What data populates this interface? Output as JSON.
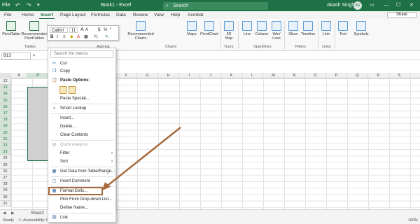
{
  "titlebar": {
    "file_label": "File",
    "window_title": "Book1 - Excel",
    "search_placeholder": "Search",
    "user_name": "Akash Singh",
    "avatar_initials": "AS"
  },
  "ribbon_tabs": [
    "File",
    "Home",
    "Insert",
    "Page Layout",
    "Formulas",
    "Data",
    "Review",
    "View",
    "Help",
    "Acrobat"
  ],
  "active_tab": "Insert",
  "share_label": "Share",
  "ribbon": {
    "buttons": [
      "PivotTable",
      "Recommended PivotTables",
      "Recommended Charts",
      "Maps",
      "PivotChart",
      "3D Map",
      "Line",
      "Column",
      "Win/ Loss",
      "Slicer",
      "Timeline",
      "Link",
      "Text",
      "Symbols"
    ],
    "groups": [
      "Tables",
      "Add-ins",
      "Charts",
      "Tours",
      "Sparklines",
      "Filters",
      "Links"
    ]
  },
  "mini_toolbar": {
    "font": "Calibri",
    "size": "11",
    "currency": "$",
    "percent": "%"
  },
  "formula_bar": {
    "name_box": "B13",
    "fx": "fx"
  },
  "columns": [
    "A",
    "B",
    "C",
    "D",
    "E",
    "F",
    "G",
    "H",
    "I",
    "J",
    "K",
    "L",
    "M",
    "N",
    "O",
    "P",
    "Q",
    "R",
    "S"
  ],
  "rows": [
    "12",
    "13",
    "14",
    "15",
    "16",
    "17",
    "18",
    "19",
    "20",
    "21",
    "22",
    "23",
    "24",
    "25",
    "26",
    "27",
    "28",
    "29",
    "30",
    "31"
  ],
  "context_menu": {
    "search_placeholder": "Search the menus",
    "items": [
      {
        "label": "Cut",
        "icon": "scissors-icon"
      },
      {
        "label": "Copy",
        "icon": "copy-icon"
      },
      {
        "label": "Paste Options:",
        "icon": "paste-icon"
      },
      {
        "label": "Paste Special...",
        "icon": ""
      },
      {
        "label": "Smart Lookup",
        "icon": "search-icon"
      },
      {
        "label": "Insert...",
        "icon": ""
      },
      {
        "label": "Delete...",
        "icon": ""
      },
      {
        "label": "Clear Contents",
        "icon": ""
      },
      {
        "label": "Quick Analysis",
        "icon": "quick-analysis-icon"
      },
      {
        "label": "Filter",
        "icon": ""
      },
      {
        "label": "Sort",
        "icon": ""
      },
      {
        "label": "Get Data from Table/Range...",
        "icon": "table-icon"
      },
      {
        "label": "Insert Comment",
        "icon": "comment-icon"
      },
      {
        "label": "Format Cells...",
        "icon": "format-cells-icon"
      },
      {
        "label": "Pick From Drop-down List...",
        "icon": ""
      },
      {
        "label": "Define Name...",
        "icon": ""
      },
      {
        "label": "Link",
        "icon": "link-icon"
      }
    ]
  },
  "sheet_tab": "Sheet2",
  "status": {
    "ready": "Ready",
    "accessibility": "Accessibility: In",
    "zoom": "100%"
  },
  "colors": {
    "excel_green": "#1e7145",
    "highlight_border": "#a86a3c",
    "selection_fill": "#d0d0d0"
  }
}
